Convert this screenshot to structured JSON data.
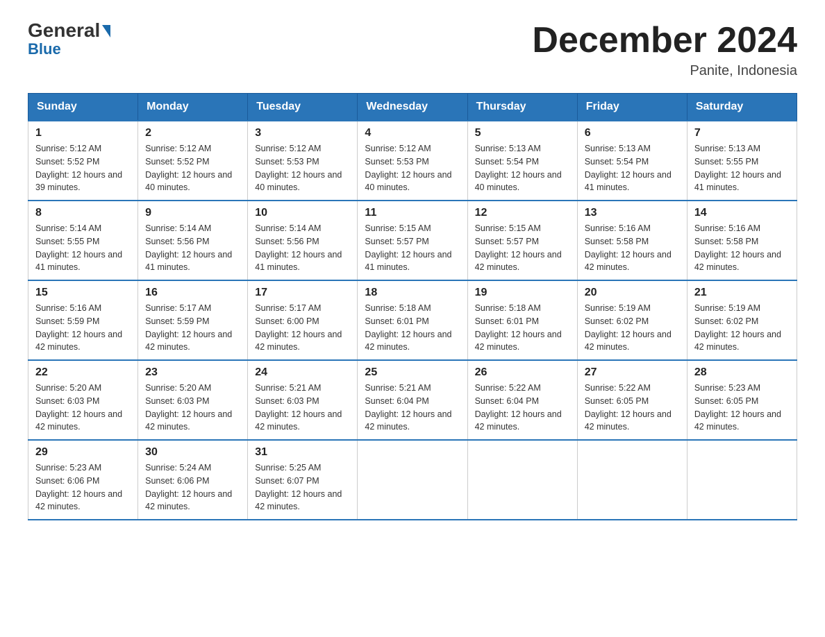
{
  "logo": {
    "general": "General",
    "blue": "Blue"
  },
  "title": "December 2024",
  "location": "Panite, Indonesia",
  "days_of_week": [
    "Sunday",
    "Monday",
    "Tuesday",
    "Wednesday",
    "Thursday",
    "Friday",
    "Saturday"
  ],
  "weeks": [
    [
      {
        "day": "1",
        "sunrise": "5:12 AM",
        "sunset": "5:52 PM",
        "daylight": "12 hours and 39 minutes."
      },
      {
        "day": "2",
        "sunrise": "5:12 AM",
        "sunset": "5:52 PM",
        "daylight": "12 hours and 40 minutes."
      },
      {
        "day": "3",
        "sunrise": "5:12 AM",
        "sunset": "5:53 PM",
        "daylight": "12 hours and 40 minutes."
      },
      {
        "day": "4",
        "sunrise": "5:12 AM",
        "sunset": "5:53 PM",
        "daylight": "12 hours and 40 minutes."
      },
      {
        "day": "5",
        "sunrise": "5:13 AM",
        "sunset": "5:54 PM",
        "daylight": "12 hours and 40 minutes."
      },
      {
        "day": "6",
        "sunrise": "5:13 AM",
        "sunset": "5:54 PM",
        "daylight": "12 hours and 41 minutes."
      },
      {
        "day": "7",
        "sunrise": "5:13 AM",
        "sunset": "5:55 PM",
        "daylight": "12 hours and 41 minutes."
      }
    ],
    [
      {
        "day": "8",
        "sunrise": "5:14 AM",
        "sunset": "5:55 PM",
        "daylight": "12 hours and 41 minutes."
      },
      {
        "day": "9",
        "sunrise": "5:14 AM",
        "sunset": "5:56 PM",
        "daylight": "12 hours and 41 minutes."
      },
      {
        "day": "10",
        "sunrise": "5:14 AM",
        "sunset": "5:56 PM",
        "daylight": "12 hours and 41 minutes."
      },
      {
        "day": "11",
        "sunrise": "5:15 AM",
        "sunset": "5:57 PM",
        "daylight": "12 hours and 41 minutes."
      },
      {
        "day": "12",
        "sunrise": "5:15 AM",
        "sunset": "5:57 PM",
        "daylight": "12 hours and 42 minutes."
      },
      {
        "day": "13",
        "sunrise": "5:16 AM",
        "sunset": "5:58 PM",
        "daylight": "12 hours and 42 minutes."
      },
      {
        "day": "14",
        "sunrise": "5:16 AM",
        "sunset": "5:58 PM",
        "daylight": "12 hours and 42 minutes."
      }
    ],
    [
      {
        "day": "15",
        "sunrise": "5:16 AM",
        "sunset": "5:59 PM",
        "daylight": "12 hours and 42 minutes."
      },
      {
        "day": "16",
        "sunrise": "5:17 AM",
        "sunset": "5:59 PM",
        "daylight": "12 hours and 42 minutes."
      },
      {
        "day": "17",
        "sunrise": "5:17 AM",
        "sunset": "6:00 PM",
        "daylight": "12 hours and 42 minutes."
      },
      {
        "day": "18",
        "sunrise": "5:18 AM",
        "sunset": "6:01 PM",
        "daylight": "12 hours and 42 minutes."
      },
      {
        "day": "19",
        "sunrise": "5:18 AM",
        "sunset": "6:01 PM",
        "daylight": "12 hours and 42 minutes."
      },
      {
        "day": "20",
        "sunrise": "5:19 AM",
        "sunset": "6:02 PM",
        "daylight": "12 hours and 42 minutes."
      },
      {
        "day": "21",
        "sunrise": "5:19 AM",
        "sunset": "6:02 PM",
        "daylight": "12 hours and 42 minutes."
      }
    ],
    [
      {
        "day": "22",
        "sunrise": "5:20 AM",
        "sunset": "6:03 PM",
        "daylight": "12 hours and 42 minutes."
      },
      {
        "day": "23",
        "sunrise": "5:20 AM",
        "sunset": "6:03 PM",
        "daylight": "12 hours and 42 minutes."
      },
      {
        "day": "24",
        "sunrise": "5:21 AM",
        "sunset": "6:03 PM",
        "daylight": "12 hours and 42 minutes."
      },
      {
        "day": "25",
        "sunrise": "5:21 AM",
        "sunset": "6:04 PM",
        "daylight": "12 hours and 42 minutes."
      },
      {
        "day": "26",
        "sunrise": "5:22 AM",
        "sunset": "6:04 PM",
        "daylight": "12 hours and 42 minutes."
      },
      {
        "day": "27",
        "sunrise": "5:22 AM",
        "sunset": "6:05 PM",
        "daylight": "12 hours and 42 minutes."
      },
      {
        "day": "28",
        "sunrise": "5:23 AM",
        "sunset": "6:05 PM",
        "daylight": "12 hours and 42 minutes."
      }
    ],
    [
      {
        "day": "29",
        "sunrise": "5:23 AM",
        "sunset": "6:06 PM",
        "daylight": "12 hours and 42 minutes."
      },
      {
        "day": "30",
        "sunrise": "5:24 AM",
        "sunset": "6:06 PM",
        "daylight": "12 hours and 42 minutes."
      },
      {
        "day": "31",
        "sunrise": "5:25 AM",
        "sunset": "6:07 PM",
        "daylight": "12 hours and 42 minutes."
      },
      null,
      null,
      null,
      null
    ]
  ]
}
